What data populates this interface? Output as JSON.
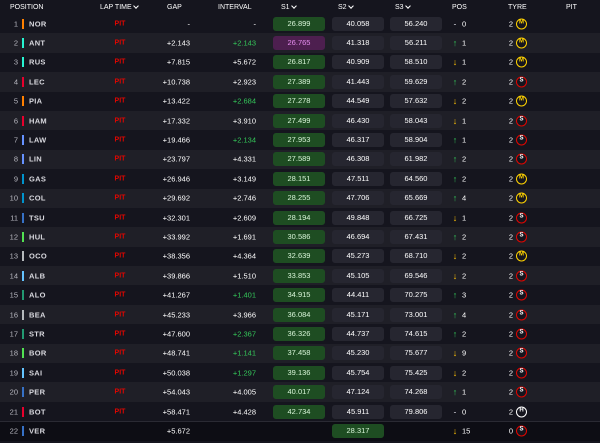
{
  "columns": {
    "position": "POSITION",
    "lap_time": "LAP TIME",
    "gap": "GAP",
    "interval": "INTERVAL",
    "s1": "S1",
    "s2": "S2",
    "s3": "S3",
    "pos": "POS",
    "tyre": "TYRE",
    "pit": "PIT"
  },
  "colors": {
    "pit_red": "#e10600",
    "interval_green": "#34c759",
    "personal_best_bg": "#1e4d22",
    "fastest_bg": "#4d1f4f",
    "fastest_text": "#e78ef0",
    "gain_green": "#34c759",
    "loss_yellow": "#ffc107"
  },
  "rows": [
    {
      "pos": "1",
      "driver": "NOR",
      "team_color": "#ff8000",
      "lap": "PIT",
      "gap": "-",
      "interval": "-",
      "interval_green": false,
      "s1": "26.899",
      "s1_style": "pb",
      "s2": "40.058",
      "s2_style": "plain",
      "s3": "56.240",
      "s3_style": "plain",
      "dir": "same",
      "arrow": "-",
      "pos_change": "0",
      "tyre_laps": "2",
      "tyre": "medium",
      "tyre_letter": "M"
    },
    {
      "pos": "2",
      "driver": "ANT",
      "team_color": "#27f4d2",
      "lap": "PIT",
      "gap": "+2.143",
      "interval": "+2.143",
      "interval_green": true,
      "s1": "26.765",
      "s1_style": "fastest",
      "s2": "41.318",
      "s2_style": "plain",
      "s3": "56.211",
      "s3_style": "plain",
      "dir": "up",
      "arrow": "↑",
      "pos_change": "1",
      "tyre_laps": "2",
      "tyre": "medium",
      "tyre_letter": "M"
    },
    {
      "pos": "3",
      "driver": "RUS",
      "team_color": "#27f4d2",
      "lap": "PIT",
      "gap": "+7.815",
      "interval": "+5.672",
      "interval_green": false,
      "s1": "26.817",
      "s1_style": "pb",
      "s2": "40.909",
      "s2_style": "plain",
      "s3": "58.510",
      "s3_style": "plain",
      "dir": "down",
      "arrow": "↓",
      "pos_change": "1",
      "tyre_laps": "2",
      "tyre": "medium",
      "tyre_letter": "M"
    },
    {
      "pos": "4",
      "driver": "LEC",
      "team_color": "#e8002d",
      "lap": "PIT",
      "gap": "+10.738",
      "interval": "+2.923",
      "interval_green": false,
      "s1": "27.389",
      "s1_style": "pb",
      "s2": "41.443",
      "s2_style": "plain",
      "s3": "59.629",
      "s3_style": "plain",
      "dir": "up",
      "arrow": "↑",
      "pos_change": "2",
      "tyre_laps": "2",
      "tyre": "soft",
      "tyre_letter": "S"
    },
    {
      "pos": "5",
      "driver": "PIA",
      "team_color": "#ff8000",
      "lap": "PIT",
      "gap": "+13.422",
      "interval": "+2.684",
      "interval_green": true,
      "s1": "27.278",
      "s1_style": "pb",
      "s2": "44.549",
      "s2_style": "plain",
      "s3": "57.632",
      "s3_style": "plain",
      "dir": "down",
      "arrow": "↓",
      "pos_change": "2",
      "tyre_laps": "2",
      "tyre": "medium",
      "tyre_letter": "M"
    },
    {
      "pos": "6",
      "driver": "HAM",
      "team_color": "#e8002d",
      "lap": "PIT",
      "gap": "+17.332",
      "interval": "+3.910",
      "interval_green": false,
      "s1": "27.499",
      "s1_style": "pb",
      "s2": "46.430",
      "s2_style": "plain",
      "s3": "58.043",
      "s3_style": "plain",
      "dir": "down",
      "arrow": "↓",
      "pos_change": "1",
      "tyre_laps": "2",
      "tyre": "soft",
      "tyre_letter": "S"
    },
    {
      "pos": "7",
      "driver": "LAW",
      "team_color": "#6692ff",
      "lap": "PIT",
      "gap": "+19.466",
      "interval": "+2.134",
      "interval_green": true,
      "s1": "27.953",
      "s1_style": "pb",
      "s2": "46.317",
      "s2_style": "plain",
      "s3": "58.904",
      "s3_style": "plain",
      "dir": "up",
      "arrow": "↑",
      "pos_change": "1",
      "tyre_laps": "2",
      "tyre": "soft",
      "tyre_letter": "S"
    },
    {
      "pos": "8",
      "driver": "LIN",
      "team_color": "#6692ff",
      "lap": "PIT",
      "gap": "+23.797",
      "interval": "+4.331",
      "interval_green": false,
      "s1": "27.589",
      "s1_style": "pb",
      "s2": "46.308",
      "s2_style": "plain",
      "s3": "61.982",
      "s3_style": "plain",
      "dir": "up",
      "arrow": "↑",
      "pos_change": "2",
      "tyre_laps": "2",
      "tyre": "soft",
      "tyre_letter": "S"
    },
    {
      "pos": "9",
      "driver": "GAS",
      "team_color": "#0093cc",
      "lap": "PIT",
      "gap": "+26.946",
      "interval": "+3.149",
      "interval_green": false,
      "s1": "28.151",
      "s1_style": "pb",
      "s2": "47.511",
      "s2_style": "plain",
      "s3": "64.560",
      "s3_style": "plain",
      "dir": "up",
      "arrow": "↑",
      "pos_change": "2",
      "tyre_laps": "2",
      "tyre": "medium",
      "tyre_letter": "M"
    },
    {
      "pos": "10",
      "driver": "COL",
      "team_color": "#0093cc",
      "lap": "PIT",
      "gap": "+29.692",
      "interval": "+2.746",
      "interval_green": false,
      "s1": "28.255",
      "s1_style": "pb",
      "s2": "47.706",
      "s2_style": "plain",
      "s3": "65.669",
      "s3_style": "plain",
      "dir": "up",
      "arrow": "↑",
      "pos_change": "4",
      "tyre_laps": "2",
      "tyre": "medium",
      "tyre_letter": "M"
    },
    {
      "pos": "11",
      "driver": "TSU",
      "team_color": "#3671c6",
      "lap": "PIT",
      "gap": "+32.301",
      "interval": "+2.609",
      "interval_green": false,
      "s1": "28.194",
      "s1_style": "pb",
      "s2": "49.848",
      "s2_style": "plain",
      "s3": "66.725",
      "s3_style": "plain",
      "dir": "down",
      "arrow": "↓",
      "pos_change": "1",
      "tyre_laps": "2",
      "tyre": "soft",
      "tyre_letter": "S"
    },
    {
      "pos": "12",
      "driver": "HUL",
      "team_color": "#52e252",
      "lap": "PIT",
      "gap": "+33.992",
      "interval": "+1.691",
      "interval_green": false,
      "s1": "30.586",
      "s1_style": "pb",
      "s2": "46.694",
      "s2_style": "plain",
      "s3": "67.431",
      "s3_style": "plain",
      "dir": "up",
      "arrow": "↑",
      "pos_change": "2",
      "tyre_laps": "2",
      "tyre": "soft",
      "tyre_letter": "S"
    },
    {
      "pos": "13",
      "driver": "OCO",
      "team_color": "#b6babd",
      "lap": "PIT",
      "gap": "+38.356",
      "interval": "+4.364",
      "interval_green": false,
      "s1": "32.639",
      "s1_style": "pb",
      "s2": "45.273",
      "s2_style": "plain",
      "s3": "68.710",
      "s3_style": "plain",
      "dir": "down",
      "arrow": "↓",
      "pos_change": "2",
      "tyre_laps": "2",
      "tyre": "medium",
      "tyre_letter": "M"
    },
    {
      "pos": "14",
      "driver": "ALB",
      "team_color": "#64c4ff",
      "lap": "PIT",
      "gap": "+39.866",
      "interval": "+1.510",
      "interval_green": false,
      "s1": "33.853",
      "s1_style": "pb",
      "s2": "45.105",
      "s2_style": "plain",
      "s3": "69.546",
      "s3_style": "plain",
      "dir": "down",
      "arrow": "↓",
      "pos_change": "2",
      "tyre_laps": "2",
      "tyre": "soft",
      "tyre_letter": "S"
    },
    {
      "pos": "15",
      "driver": "ALO",
      "team_color": "#229971",
      "lap": "PIT",
      "gap": "+41.267",
      "interval": "+1.401",
      "interval_green": true,
      "s1": "34.915",
      "s1_style": "pb",
      "s2": "44.411",
      "s2_style": "plain",
      "s3": "70.275",
      "s3_style": "plain",
      "dir": "up",
      "arrow": "↑",
      "pos_change": "3",
      "tyre_laps": "2",
      "tyre": "soft",
      "tyre_letter": "S"
    },
    {
      "pos": "16",
      "driver": "BEA",
      "team_color": "#b6babd",
      "lap": "PIT",
      "gap": "+45.233",
      "interval": "+3.966",
      "interval_green": false,
      "s1": "36.084",
      "s1_style": "pb",
      "s2": "45.171",
      "s2_style": "plain",
      "s3": "73.001",
      "s3_style": "plain",
      "dir": "up",
      "arrow": "↑",
      "pos_change": "4",
      "tyre_laps": "2",
      "tyre": "soft",
      "tyre_letter": "S"
    },
    {
      "pos": "17",
      "driver": "STR",
      "team_color": "#229971",
      "lap": "PIT",
      "gap": "+47.600",
      "interval": "+2.367",
      "interval_green": true,
      "s1": "36.326",
      "s1_style": "pb",
      "s2": "44.737",
      "s2_style": "plain",
      "s3": "74.615",
      "s3_style": "plain",
      "dir": "up",
      "arrow": "↑",
      "pos_change": "2",
      "tyre_laps": "2",
      "tyre": "soft",
      "tyre_letter": "S"
    },
    {
      "pos": "18",
      "driver": "BOR",
      "team_color": "#52e252",
      "lap": "PIT",
      "gap": "+48.741",
      "interval": "+1.141",
      "interval_green": true,
      "s1": "37.458",
      "s1_style": "pb",
      "s2": "45.230",
      "s2_style": "plain",
      "s3": "75.677",
      "s3_style": "plain",
      "dir": "down",
      "arrow": "↓",
      "pos_change": "9",
      "tyre_laps": "2",
      "tyre": "soft",
      "tyre_letter": "S"
    },
    {
      "pos": "19",
      "driver": "SAI",
      "team_color": "#64c4ff",
      "lap": "PIT",
      "gap": "+50.038",
      "interval": "+1.297",
      "interval_green": true,
      "s1": "39.136",
      "s1_style": "pb",
      "s2": "45.754",
      "s2_style": "plain",
      "s3": "75.425",
      "s3_style": "plain",
      "dir": "down",
      "arrow": "↓",
      "pos_change": "2",
      "tyre_laps": "2",
      "tyre": "soft",
      "tyre_letter": "S"
    },
    {
      "pos": "20",
      "driver": "PER",
      "team_color": "#3671c6",
      "lap": "PIT",
      "gap": "+54.043",
      "interval": "+4.005",
      "interval_green": false,
      "s1": "40.017",
      "s1_style": "pb",
      "s2": "47.124",
      "s2_style": "plain",
      "s3": "74.268",
      "s3_style": "plain",
      "dir": "up",
      "arrow": "↑",
      "pos_change": "1",
      "tyre_laps": "2",
      "tyre": "soft",
      "tyre_letter": "S"
    },
    {
      "pos": "21",
      "driver": "BOT",
      "team_color": "#e8002d",
      "lap": "PIT",
      "gap": "+58.471",
      "interval": "+4.428",
      "interval_green": false,
      "s1": "42.734",
      "s1_style": "pb",
      "s2": "45.911",
      "s2_style": "plain",
      "s3": "79.806",
      "s3_style": "plain",
      "dir": "same",
      "arrow": "-",
      "pos_change": "0",
      "tyre_laps": "2",
      "tyre": "hard",
      "tyre_letter": "H"
    },
    {
      "pos": "22",
      "driver": "VER",
      "team_color": "#3671c6",
      "lap": "",
      "gap": "+5.672",
      "interval": "",
      "interval_green": false,
      "s1": "",
      "s1_style": "empty",
      "s2": "28.317",
      "s2_style": "pb",
      "s3": "",
      "s3_style": "empty",
      "dir": "down",
      "arrow": "↓",
      "pos_change": "15",
      "tyre_laps": "0",
      "tyre": "soft",
      "tyre_letter": "S",
      "highlight": true
    }
  ]
}
